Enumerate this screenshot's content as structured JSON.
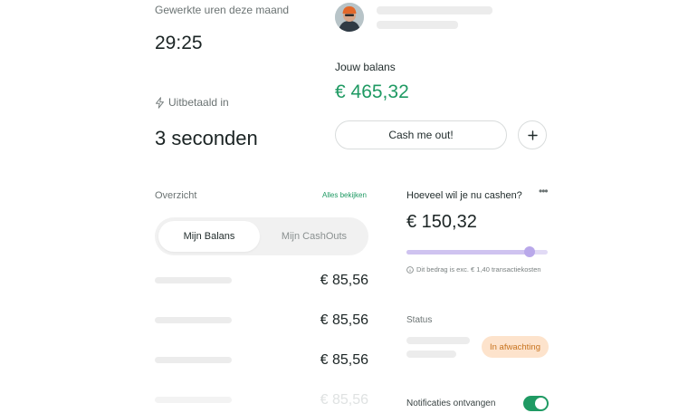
{
  "stats": {
    "worked_label": "Gewerkte uren deze maand",
    "worked_value": "29:25",
    "paid_label": "Uitbetaald in",
    "paid_value": "3 seconden"
  },
  "balance": {
    "label": "Jouw balans",
    "value": "€ 465,32",
    "cash_button": "Cash me out!"
  },
  "overview": {
    "label": "Overzicht",
    "see_all": "Alles bekijken",
    "tabs": [
      "Mijn Balans",
      "Mijn CashOuts"
    ],
    "rows": [
      "€ 85,56",
      "€ 85,56",
      "€ 85,56",
      "€ 85,56"
    ]
  },
  "cashout": {
    "question": "Hoeveel wil je nu cashen?",
    "amount": "€ 150,32",
    "slider_fraction": 0.87,
    "fee_note": "Dit bedrag is exc. € 1,40 transactiekosten"
  },
  "status": {
    "label": "Status",
    "badge": "In afwachting"
  },
  "notifications": {
    "label": "Notificaties ontvangen",
    "enabled": true
  },
  "colors": {
    "accent_green": "#1f9a63",
    "pending_bg": "#fde3cc",
    "pending_text": "#c8741f",
    "slider": "#cfc3f0"
  },
  "icons": [
    "lightning-icon",
    "plus-icon",
    "more-dots-icon",
    "info-icon",
    "avatar"
  ]
}
